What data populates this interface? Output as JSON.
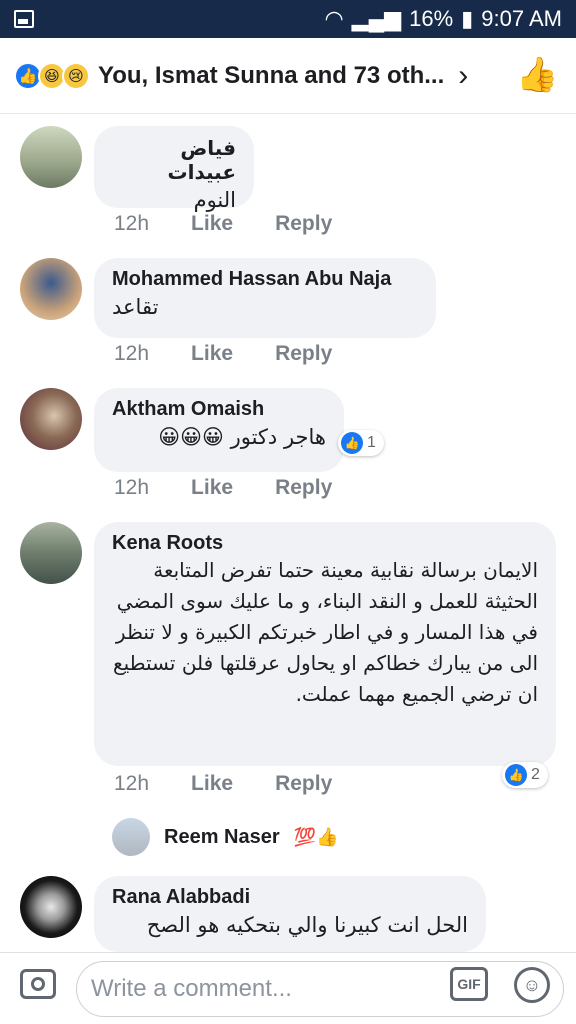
{
  "status_bar": {
    "battery": "16%",
    "time": "9:07 AM"
  },
  "header": {
    "title": "You, Ismat Sunna and 73 oth...",
    "reaction_icons": [
      "like-icon",
      "haha-icon",
      "sad-icon"
    ],
    "chevron_icon": "chevron-right-icon",
    "thumb_icon": "thumbs-up-icon"
  },
  "comments": [
    {
      "name": "فياض عبيدات",
      "text": "النوم",
      "time": "12h",
      "like": "Like",
      "reply": "Reply"
    },
    {
      "name": "Mohammed Hassan Abu Naja",
      "text": "تقاعد",
      "time": "12h",
      "like": "Like",
      "reply": "Reply"
    },
    {
      "name": "Aktham Omaish",
      "text": "هاجر دكتور 😀😀😀",
      "time": "12h",
      "like": "Like",
      "reply": "Reply",
      "reactions": "1"
    },
    {
      "name": "Kena Roots",
      "text": "الايمان برسالة نقابية معينة حتما تفرض المتابعة الحثيثة للعمل و النقد البناء، و ما عليك سوى المضي في هذا المسار و في اطار خبرتكم الكبيرة و لا تنظر الى من يبارك خطاكم او يحاول عرقلتها فلن تستطيع ان ترضي الجميع مهما عملت.",
      "time": "12h",
      "like": "Like",
      "reply": "Reply",
      "reactions": "2"
    },
    {
      "name": "Rana Alabbadi",
      "text": "الحل انت كبيرنا والي بتحكيه هو الصح"
    }
  ],
  "reply_preview": {
    "name": "Reem Naser",
    "emoji": "💯👍"
  },
  "composer": {
    "placeholder": "Write a comment...",
    "gif_label": "GIF"
  },
  "colors": {
    "accent": "#1877f2",
    "status_bar_bg": "#172a4a",
    "bubble_bg": "#f0f2f5"
  }
}
